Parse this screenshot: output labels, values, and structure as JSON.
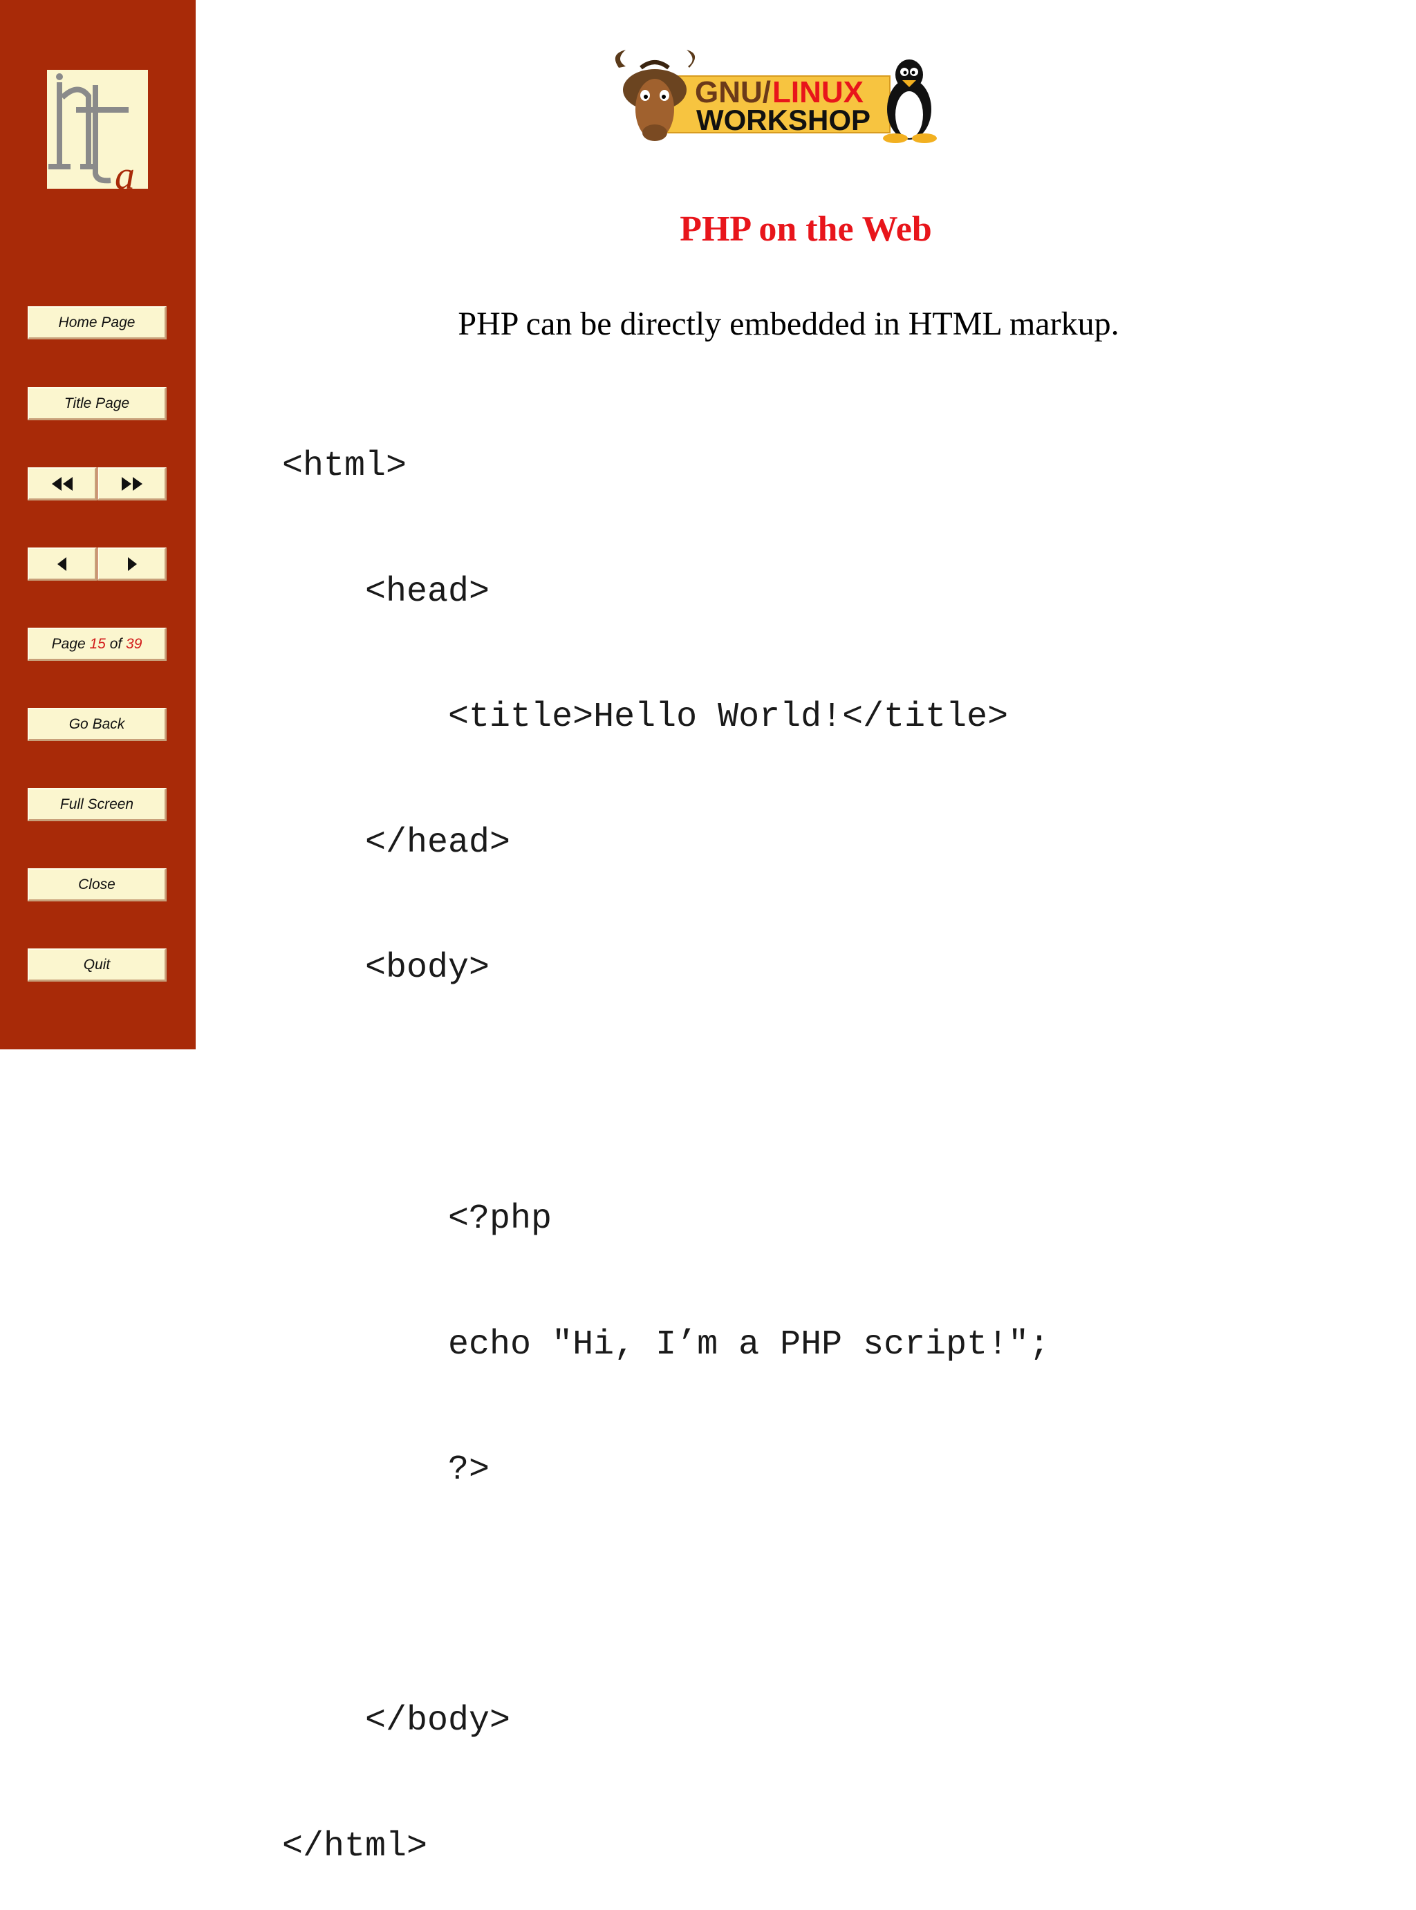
{
  "sidebar": {
    "logo_text": "ita",
    "home_label": "Home Page",
    "title_label": "Title Page",
    "go_back_label": "Go Back",
    "full_screen_label": "Full Screen",
    "close_label": "Close",
    "quit_label": "Quit",
    "page_indicator": {
      "prefix": "Page",
      "current": "15",
      "separator": "of",
      "total": "39"
    },
    "colors": {
      "background": "#a82a08",
      "button": "#fbf6cf",
      "highlight": "#d21b1b"
    }
  },
  "header_logo": {
    "line1_part1": "GNU/",
    "line1_part2": "LINUX",
    "line2": "WORKSHOP"
  },
  "slide": {
    "title": "PHP on the Web",
    "subtitle": "PHP can be directly embedded in HTML markup.",
    "code_lines": [
      "<html>",
      "    <head>",
      "        <title>Hello World!</title>",
      "    </head>",
      "    <body>",
      "",
      "        <?php",
      "        echo \"Hi, I’m a PHP script!\";",
      "        ?>",
      "",
      "    </body>",
      "</html>"
    ]
  }
}
